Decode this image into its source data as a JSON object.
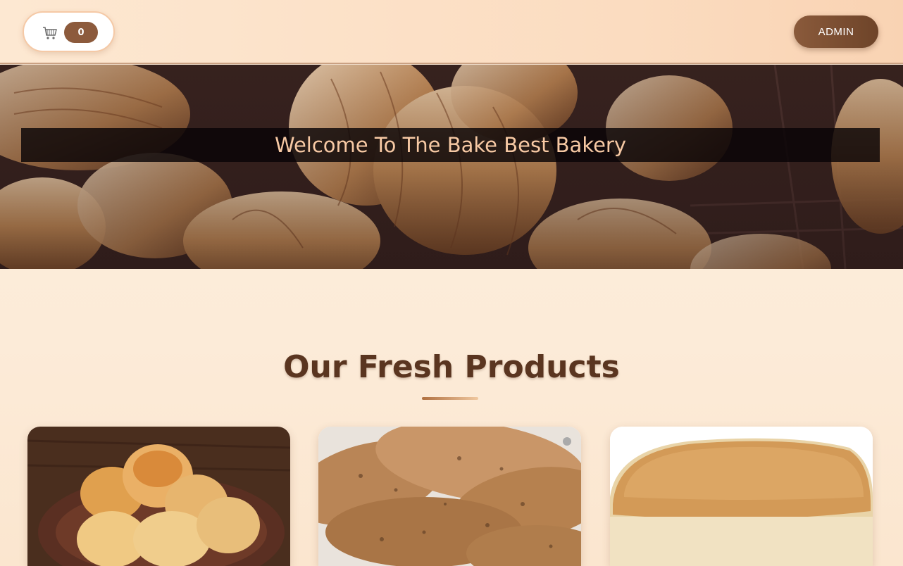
{
  "header": {
    "cart_count": "0",
    "cart_icon": "shopping-cart-icon",
    "admin_label": "ADMIN"
  },
  "hero": {
    "title": "Welcome To The Bake Best Bakery"
  },
  "products": {
    "section_title": "Our Fresh Products",
    "items": [
      {
        "image": "scones-photo"
      },
      {
        "image": "oat-cookies-photo"
      },
      {
        "image": "bread-loaf-photo"
      }
    ]
  },
  "colors": {
    "accent": "#8c5a3c",
    "title": "#5a3520",
    "hero_text": "#f7c9a4"
  }
}
